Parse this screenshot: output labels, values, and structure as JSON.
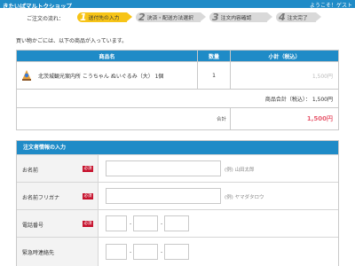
{
  "header": {
    "shop_name": "きたいばマルトクショップ",
    "welcome": "ようこそ！ゲスト"
  },
  "flow": {
    "label": "ご注文の流れ：",
    "steps": [
      {
        "num": "1",
        "label": "送付先の入力",
        "active": true
      },
      {
        "num": "2",
        "label": "決済・配送方法選択",
        "active": false
      },
      {
        "num": "3",
        "label": "注文内容確認",
        "active": false
      },
      {
        "num": "4",
        "label": "注文完了",
        "active": false
      }
    ]
  },
  "intro": "買い物かごには、以下の商品が入っています。",
  "cart": {
    "headers": {
      "product": "商品名",
      "qty": "数量",
      "subtotal": "小計（税込）"
    },
    "items": [
      {
        "name": "北茨城観光案内所 こうちゃん ぬいぐるみ（大） 1個",
        "qty": "1",
        "price": "1,500円",
        "thumb_icon": "plush-toy-image"
      }
    ],
    "product_total_label": "商品合計（税込）：",
    "product_total_value": "1,500円",
    "total_label": "合計",
    "total_value": "1,500円"
  },
  "form": {
    "title": "注文者情報の入力",
    "required_badge": "必須",
    "fields": {
      "name": {
        "label": "お名前",
        "hint": "(例) 山田太郎"
      },
      "kana": {
        "label": "お名前フリガナ",
        "hint": "(例) ヤマダタロウ"
      },
      "phone": {
        "label": "電話番号",
        "sep": "-"
      },
      "emergency": {
        "label": "緊急時連絡先",
        "sep": "-"
      }
    }
  },
  "colors": {
    "brand_blue": "#1f8bc7",
    "active_step": "#f7c417",
    "required_red": "#c6122d",
    "total_pink": "#e85c70"
  }
}
